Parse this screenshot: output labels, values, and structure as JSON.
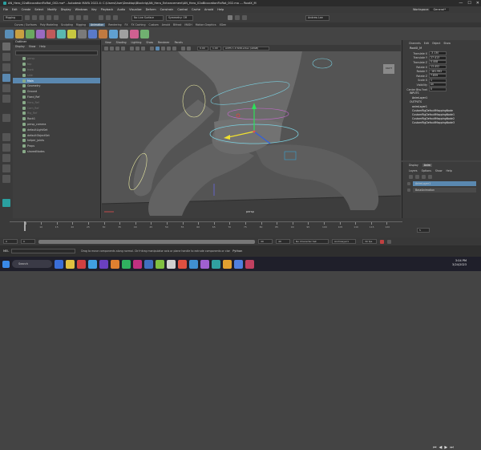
{
  "window": {
    "title": "AN_Hero_02oBicocationFixRot_002.ma* - Autodesk MAYA 2022.4: C:\\Users\\User\\Desktop\\Blockrig\\AN_Hero_Enhancement\\AN_Hero_02oBicocationFixRot_002.ma --- RootX_M",
    "controls": [
      "—",
      "☐",
      "✕"
    ]
  },
  "menubar": {
    "items": [
      "File",
      "Edit",
      "Create",
      "Select",
      "Modify",
      "Display",
      "Windows",
      "Key",
      "Playback",
      "Audio",
      "Visualize",
      "Deform",
      "Constrain",
      "Control",
      "Cache",
      "Arnold",
      "Help"
    ],
    "workspace_label": "Workspace:",
    "workspace_value": "General*"
  },
  "statusline": {
    "mode": "Rigging",
    "live_surface": "No Live Surface",
    "symmetry": "Symmetry: Off",
    "user": "Andrew Lee"
  },
  "shelf": {
    "tabs": [
      "Curves / Surfaces",
      "Poly Modeling",
      "Sculpting",
      "Rigging",
      "Animation",
      "Rendering",
      "FX",
      "FX Caching",
      "Custom",
      "Arnold",
      "Bifrost",
      "MASH",
      "Motion Graphics",
      "XGen"
    ],
    "active_tab": "Animation",
    "icon_colors": [
      "#5a8fb8",
      "#c8a040",
      "#6aa860",
      "#9a6ac0",
      "#c05a5a",
      "#5ab8b0",
      "#c8c840",
      "#7a7a7a",
      "#5a7ac8",
      "#c07a40",
      "#60a0d0",
      "#a0a0a0",
      "#d06090",
      "#70b070"
    ]
  },
  "outliner": {
    "title": "Outliner",
    "menu": [
      "Display",
      "Show",
      "Help"
    ],
    "items": [
      {
        "label": "persp",
        "state": "dim"
      },
      {
        "label": "top",
        "state": "dim"
      },
      {
        "label": "front",
        "state": "dim"
      },
      {
        "label": "side",
        "state": "dim"
      },
      {
        "label": "Main",
        "state": "sel"
      },
      {
        "label": "Geometry",
        "state": ""
      },
      {
        "label": "Ground",
        "state": ""
      },
      {
        "label": "Fixed_Ref",
        "state": ""
      },
      {
        "label": "Hero_Ref",
        "state": "dim"
      },
      {
        "label": "Cam_Ref",
        "state": "dim"
      },
      {
        "label": "Rig_Ref",
        "state": "dim"
      },
      {
        "label": "Rock1",
        "state": ""
      },
      {
        "label": "persp_camera",
        "state": ""
      },
      {
        "label": "defaultLightSet",
        "state": ""
      },
      {
        "label": "defaultObjectSet",
        "state": ""
      },
      {
        "label": "helper_joints",
        "state": ""
      },
      {
        "label": "Props",
        "state": ""
      },
      {
        "label": "sharedNodes",
        "state": ""
      }
    ]
  },
  "viewport": {
    "menu": [
      "View",
      "Shading",
      "Lighting",
      "Show",
      "Renderer",
      "Panels"
    ],
    "field_value": "0.00",
    "field_value2": "1.00",
    "colorspace": "ACES 1.0 SDR-video (sRGB)",
    "camera_label": "persp",
    "viewcube_label": "RIGHT"
  },
  "channels": {
    "menu": [
      "Channels",
      "Edit",
      "Object",
      "Show"
    ],
    "object_name": "RootX_M",
    "attributes": [
      {
        "label": "Translate X",
        "value": "-3.130"
      },
      {
        "label": "Translate Y",
        "value": "27.413"
      },
      {
        "label": "Translate Z",
        "value": "0.408"
      },
      {
        "label": "Rotate X",
        "value": "13.452"
      },
      {
        "label": "Rotate Y",
        "value": "-181.992"
      },
      {
        "label": "Rotate Z",
        "value": "7.859"
      },
      {
        "label": "Scale X",
        "value": "1"
      },
      {
        "label": "Visibility",
        "value": "on"
      },
      {
        "label": "Center Btw Feet",
        "value": "0"
      }
    ],
    "inputs_label": "INPUTS",
    "input_item": "AnimLayer1",
    "outputs_label": "OUTPUTS",
    "output_items": [
      "animLayer1",
      "CustomRigDefaultMappingNode",
      "CustomRigDefaultMappingNode1",
      "CustomRigDefaultMappingNode2",
      "CustomRigDefaultMappingNode3"
    ]
  },
  "layers": {
    "tabs": [
      "Display",
      "Anim"
    ],
    "active_tab": "Anim",
    "menu": [
      "Layers",
      "Options",
      "Show",
      "Help"
    ],
    "rows": [
      {
        "label": "AnimLayer1",
        "color": "#5a88b0"
      },
      {
        "label": "BaseAnimation",
        "color": "#4a4a4a"
      }
    ]
  },
  "timeslider": {
    "ticks": [
      "5",
      "10",
      "15",
      "20",
      "25",
      "30",
      "35",
      "40",
      "45",
      "50",
      "55",
      "60",
      "65",
      "70",
      "75",
      "80",
      "85",
      "90",
      "95",
      "100",
      "105",
      "110",
      "115",
      "120"
    ],
    "current_frame": "5",
    "playback_icons": [
      "⏮",
      "◀",
      "▶",
      "⏭"
    ]
  },
  "range": {
    "start": "0",
    "start2": "0",
    "end": "49",
    "end2": "49",
    "character_set": "No Character Set",
    "anim_layer": "AnimLayer1",
    "fps": "30 fps"
  },
  "command": {
    "mode": "MEL",
    "help_text": "Drag to move components along normal. Ctrl+drag manipulator axis or plane handle to extrude components or clone objects.",
    "script_label": "Python"
  },
  "taskbar": {
    "search_placeholder": "Search",
    "app_colors": [
      "#3a6ed8",
      "#e0c040",
      "#d04040",
      "#40a0e0",
      "#6a40c0",
      "#e08030",
      "#30b060",
      "#c03080",
      "#4070c0",
      "#80c040",
      "#d0d0d0",
      "#e05040",
      "#4090d0",
      "#a060d0",
      "#30a0a0",
      "#e0a030",
      "#5080e0",
      "#c04060"
    ],
    "time": "3:04 PM",
    "date": "3/24/2023"
  }
}
